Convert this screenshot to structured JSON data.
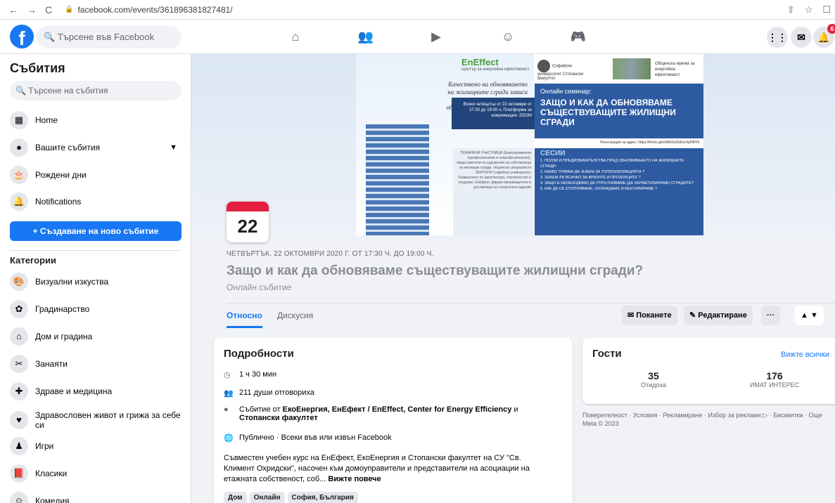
{
  "browser": {
    "url": "facebook.com/events/361896381827481/",
    "back": "←",
    "forward": "→",
    "reload": "C",
    "lock": "🔒",
    "share": "⇪",
    "star": "☆",
    "panel": "☐"
  },
  "top": {
    "logo": "f",
    "search_placeholder": "Търсене във Facebook",
    "notification_count": "6"
  },
  "sidebar": {
    "title": "Събития",
    "search_placeholder": "Търсене на събития",
    "items": [
      {
        "label": "Home",
        "icon": "calendar-icon"
      },
      {
        "label": "Вашите събития",
        "icon": "person-icon"
      },
      {
        "label": "Рождени дни",
        "icon": "cake-icon"
      },
      {
        "label": "Notifications",
        "icon": "bell-icon"
      }
    ],
    "create_label": "+ Създаване на ново събитие",
    "categories_title": "Категории",
    "categories": [
      "Визуални изкуства",
      "Градинарство",
      "Дом и градина",
      "Занаяти",
      "Здраве и медицина",
      "Здравословен живот и грижа за себе си",
      "Игри",
      "Класики",
      "Комедия"
    ]
  },
  "banner": {
    "logo_name": "EnEffect",
    "logo_sub": "Център за енергийна ефективност",
    "uni": "Софийски университет Стопански факултет",
    "net": "Общинска мрежа за енергийна ефективност",
    "script": "Качествено на обновяването на жилищните сгради зависи от активното участие на обитателите в изпълнението",
    "info": "Всеки четвъртък от 22 октомври от 17:30 до 19:00 ч. Платформа за комуникация: ZOOM",
    "panel_sub": "Онлайн семинар:",
    "panel_title": "ЗАЩО И КАК ДА ОБНОВЯВАМЕ СЪЩЕСТВУВАЩИТЕ ЖИЛИЩНИ СГРАДИ",
    "registration": "Регистрация на адрес: https://forms.gle/rMKiDo5bEsxVpHBY8",
    "invited": "ПОКАНЕНИ УЧАСТНИЦИ Домоуправители (професионални и непрофесионални), представители на сдружения на собственици на жилищни сгради, общински специалисти ЛЕКТОРИ Софийски университет, Университет по архитектура, строителство и геодезия, ЕнЕфект, фирми-производители и доставчици на строителни изделия",
    "sessions_title": "СЕСИИ",
    "sessions": [
      "1. ПОЛЗИ И ПРЕДИЗВИКАТЕЛСТВА ПРЕД ОБНОВЯВАНЕТО НА ЖИЛИЩНИТЕ СГРАДИ",
      "2. КАКВО ТРЯБВА ДА ЗНАЕМ ЗА ТОПЛОИЗОЛАЦИЯТА ?",
      "3. ЗНАЕМ ЛИ ВСИЧКО ЗА ВРАТИТЕ И ПРОЗОРЦИТЕ ?",
      "4. ЗАЩО Е НЕОБХОДИМО ДА УПЛЪТНЯВАМЕ (ДА ХЕРМЕТИЗИРАМЕ) СГРАДИТЕ?",
      "5. КАК ДА СЕ ОТОПЛЯВАМЕ, ОХЛАЖДАМЕ И ВЕНТИЛИРАМЕ ?"
    ]
  },
  "event": {
    "day": "22",
    "date_line": "ЧЕТВЪРТЪК, 22 ОКТОМВРИ 2020 Г. ОТ 17:30 Ч. ДО 19:00 Ч.",
    "title": "Защо и как да обновяваме съществуващите жилищни сгради?",
    "type": "Онлайн събитие",
    "tab_about": "Относно",
    "tab_discussion": "Дискусия",
    "invite": "Поканете",
    "edit": "Редактиране",
    "more": "···"
  },
  "details": {
    "heading": "Подробности",
    "duration": "1 ч 30 мин",
    "responded": "211 души отговориха",
    "organizer_prefix": "Събитие от",
    "organizer": "ЕкоЕнергия, ЕнЕфект / EnEffect, Center for Energy Efficiency",
    "organizer_and": "и",
    "organizer2": "Стопански факултет",
    "privacy": "Публично · Всеки във или извън Facebook",
    "description": "Съвместен учебен курс на ЕнЕфект, ЕкоЕнергия и Стопански факултет на СУ \"Св. Климент Охридски\", насочен към домоуправители и представители на асоциации на етажната собственост, соб...",
    "see_more": "Вижте повече",
    "tags": [
      "Дом",
      "Онлайн",
      "София, България"
    ]
  },
  "guests": {
    "heading": "Гости",
    "see_all": "Вижте всички",
    "going": "35",
    "going_label": "Отидоха",
    "interested": "176",
    "interested_label": "ИМАТ ИНТЕРЕС"
  },
  "footer": {
    "links": "Поверителност · Условия · Рекламиране · Избор за реклами ▷ · Бисквитки · Още",
    "copyright": "Meta © 2023"
  }
}
